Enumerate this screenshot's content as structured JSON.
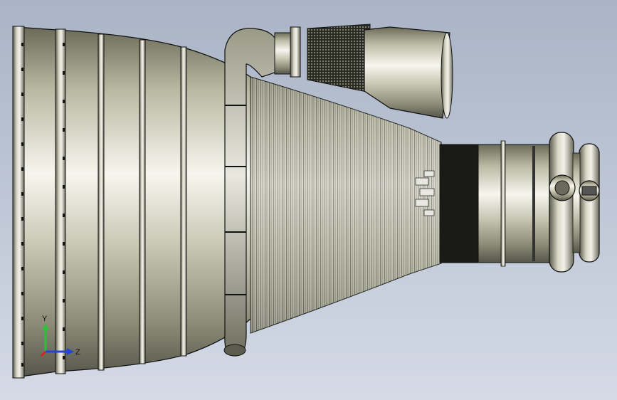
{
  "viewport": {
    "background_top": "#a9b4c6",
    "background_bottom": "#d4dae6"
  },
  "model": {
    "metal_light": "#f4f4ee",
    "metal_mid": "#b8b8a4",
    "metal_dark": "#5c5c4e",
    "edge": "#111111"
  },
  "triad": {
    "y_label": "Y",
    "z_label": "Z",
    "y_color": "#2fbf3a",
    "z_color": "#2244dd",
    "x_color": "#e02020"
  }
}
